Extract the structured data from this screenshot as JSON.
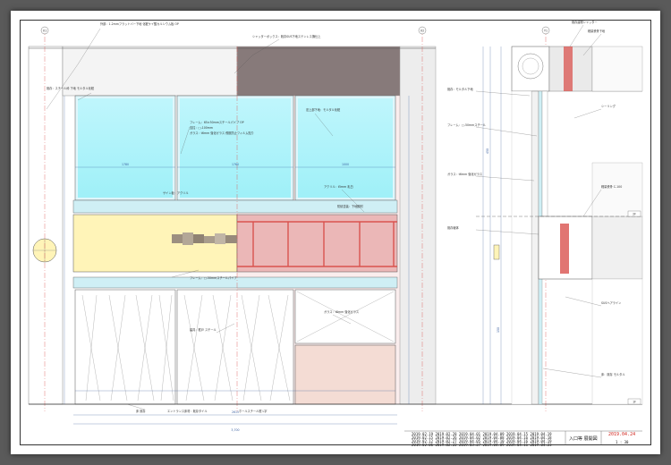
{
  "sheet": {
    "date_red": "2019.04.24",
    "scale": "1 : 30",
    "office": "入口等 展開図",
    "revisions": [
      [
        "2019.02.19",
        "2019.02.28",
        "2019.04.01",
        "2019.04.09",
        "2019.04.15",
        "2019.04.19"
      ],
      [
        "2019.02.15",
        "2019.02.26",
        "2019.04.02",
        "2019.04.08",
        "2019.04.16",
        "2019.04.18"
      ],
      [
        "2019.02.12",
        "2019.02.27",
        "2019.04.05",
        "2019.04.10",
        "2019.04.16",
        "2019.04.19"
      ],
      [
        "2019.02.06",
        "2019.02.22",
        "2019.03.27",
        "2019.04.09",
        "2019.04.11",
        "2019.04.23"
      ]
    ]
  },
  "grid": {
    "left": "X1",
    "mid": "X2",
    "right": "Y1"
  },
  "levels": {
    "upper": "2F",
    "floor": "1F"
  },
  "colors": {
    "glass": "#9ff0f8",
    "panel": "#fff4b8",
    "shutter": "#f2d4d4",
    "steel": "#d9534f",
    "dimension": "#3a5fa0",
    "centerline": "#d9534f"
  },
  "notes": {
    "top_left": "外部：1.2mmフラットバー下地 化粧ケイ酸カルシウム板 OP",
    "shutter": "シャッターボックス：既存SUS下地ステンレス撫仕上",
    "upper_left": "既存：スチール枠 下地 モルタル化粧",
    "frame1": "フレーム：65×50mmスチールパイプ OP",
    "frame2": "支柱：□-100mm",
    "glass1": "ガラス：t6mm 強化ガラス 飛散防止フィルム貼り",
    "frame_right": "窓上部下地：モルタル化粧",
    "panel_note": "サイン板：アクリル",
    "sign_note": "アクリル：t5mm 乳白",
    "steel_note": "防錆塗装：下地鋼材",
    "lower_note1": "フレーム：□-50mmスチールパイプ",
    "lower_note2": "ガラス：t8mm 強化ガラス",
    "lower_note3": "建具：框戸 スチール",
    "bottom1": "床 既存",
    "bottom2": "エントランス床材：既存タイル",
    "bottom3": "ホールスチール框 L字",
    "sec1": "既存建物シャッター",
    "sec2": "軽量鉄骨下地",
    "sec3": "既存：モルタル下地",
    "sec4": "フレーム：□-50mmスチール",
    "sec5": "シーリング",
    "sec6": "ガラス：t6mm 強化ガラス",
    "sec7": "軽量鉄骨 C-100",
    "sec8": "既存躯体",
    "sec9": "SUSヘアライン",
    "sec10": "床：既存 モルタル"
  },
  "dims": {
    "d1": "1780",
    "d2": "1760",
    "d3": "2615",
    "d4": "1000",
    "d5": "150",
    "d6": "450",
    "d7": "3,700"
  }
}
